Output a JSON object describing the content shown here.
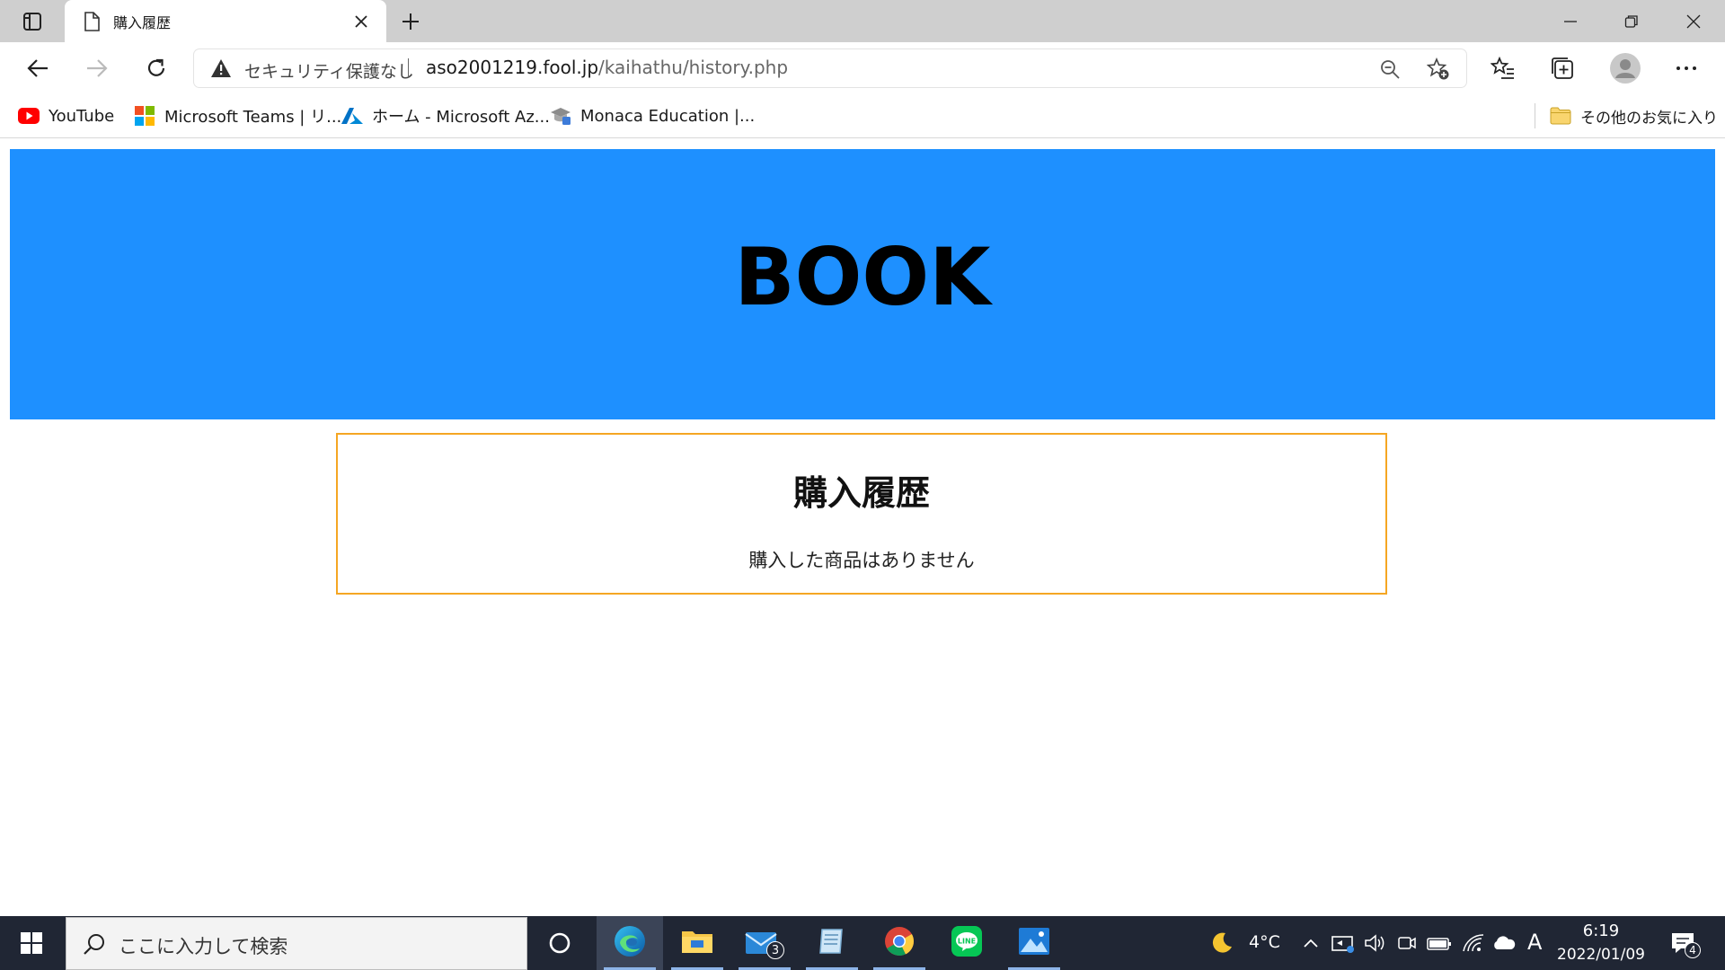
{
  "browser": {
    "tab": {
      "title": "購入履歴"
    },
    "address": {
      "security_text": "セキュリティ保護なし",
      "url_host": "aso2001219.fool.jp",
      "url_path": "/kaihathu/history.php"
    },
    "favorites": [
      {
        "label": "YouTube",
        "icon": "youtube-icon"
      },
      {
        "label": "Microsoft Teams | リ...",
        "icon": "microsoft-icon"
      },
      {
        "label": "ホーム - Microsoft Az...",
        "icon": "azure-icon"
      },
      {
        "label": "Monaca Education |...",
        "icon": "monaca-icon"
      }
    ],
    "other_favorites": "その他のお気に入り"
  },
  "page": {
    "banner_title": "BOOK",
    "panel_title": "購入履歴",
    "panel_message": "購入した商品はありません",
    "colors": {
      "banner": "#1e90ff",
      "panel_border": "#f5a623"
    }
  },
  "taskbar": {
    "search_placeholder": "ここに入力して検索",
    "mail_badge": "3",
    "weather": "4°C",
    "ime": "A",
    "time": "6:19",
    "date": "2022/01/09",
    "notification_count": "4"
  }
}
